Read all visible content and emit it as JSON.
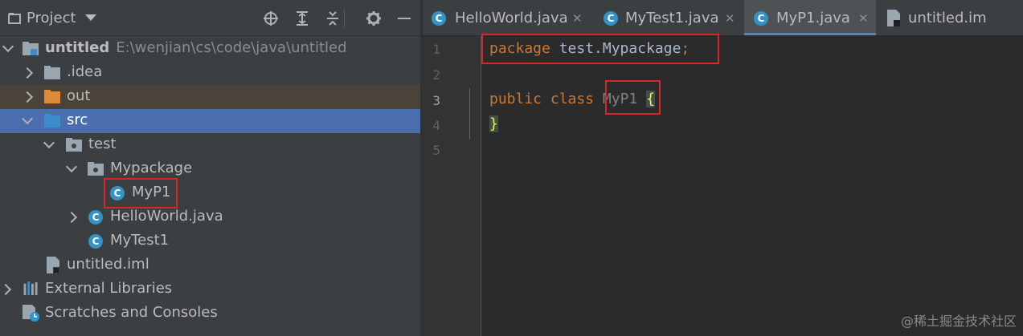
{
  "project_panel": {
    "title": "Project",
    "header_icons": [
      "locate-icon",
      "expand-all-icon",
      "collapse-all-icon",
      "gear-icon",
      "minimize-icon"
    ]
  },
  "tree": {
    "root": {
      "name": "untitled",
      "path": "E:\\wenjian\\cs\\code\\java\\untitled"
    },
    "idea": ".idea",
    "out": "out",
    "src": "src",
    "test": "test",
    "mypackage": "Mypackage",
    "myp1": "MyP1",
    "helloworld": "HelloWorld.java",
    "mytest1": "MyTest1",
    "iml": "untitled.iml",
    "external_libraries": "External Libraries",
    "scratches": "Scratches and Consoles"
  },
  "tabs": [
    {
      "label": "HelloWorld.java",
      "active": false
    },
    {
      "label": "MyTest1.java",
      "active": false
    },
    {
      "label": "MyP1.java",
      "active": true
    },
    {
      "label": "untitled.im",
      "active": false
    }
  ],
  "editor": {
    "line_numbers": [
      "1",
      "2",
      "3",
      "4",
      "5"
    ],
    "line1": {
      "keyword": "package",
      "name": "test.Mypackage",
      "semicolon": ";"
    },
    "line3": {
      "kw1": "public",
      "kw2": "class",
      "ident": "MyP1",
      "brace": "{"
    },
    "line4": {
      "brace": "}"
    }
  },
  "colors": {
    "accent": "#4a88c7",
    "selection": "#4b6eaf",
    "highlight_box": "#d62828",
    "keyword": "#cc7832",
    "class_icon": "#3592c4"
  },
  "watermark": "@稀土掘金技术社区"
}
